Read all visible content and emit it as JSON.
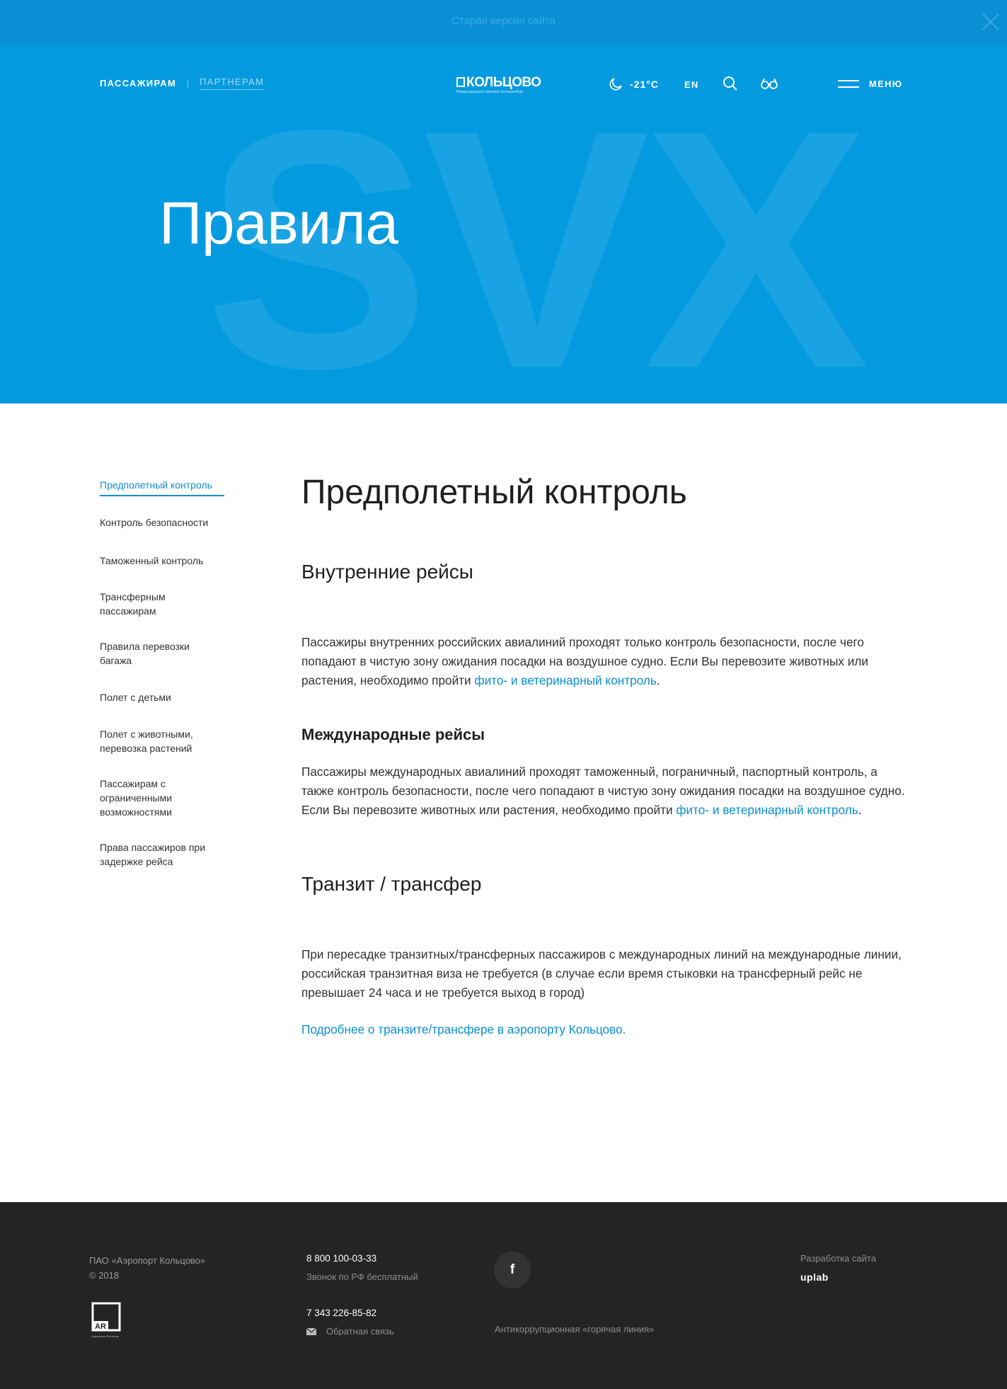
{
  "notice": {
    "text": "Старая версия сайта",
    "close_icon": "close-icon"
  },
  "header": {
    "nav": {
      "passengers": "ПАССАЖИРАМ",
      "partners": "ПАРТНЕРАМ"
    },
    "logo": {
      "text": "КОЛЬЦОВО",
      "subtext": "Международный аэропорт Екатеринбург"
    },
    "weather": {
      "icon": "moon-icon",
      "temperature": "-21°C"
    },
    "lang": "EN",
    "search_icon": "search-icon",
    "accessibility_icon": "glasses-icon",
    "menu_label": "МЕНЮ",
    "background_text": "SVX"
  },
  "hero": {
    "title": "Правила"
  },
  "sidebar": {
    "active_index": 0,
    "items": [
      {
        "label": "Предполетный контроль"
      },
      {
        "label": "Контроль безопасности"
      },
      {
        "label": "Таможенный контроль"
      },
      {
        "label": "Трансферным пассажирам"
      },
      {
        "label": "Правила перевозки багажа"
      },
      {
        "label": "Полет с детьми"
      },
      {
        "label": "Полет с животными, перевозка растений"
      },
      {
        "label": "Пассажирам с ограниченными возможностями"
      },
      {
        "label": "Права пассажиров при задержке рейса"
      }
    ]
  },
  "content": {
    "title": "Предполетный контроль",
    "domestic": {
      "heading": "Внутренние рейсы",
      "text": "Пассажиры внутренних российских авиалиний проходят только контроль безопасности, после чего попадают в чистую зону ожидания посадки на воздушное судно. Если Вы перевозите животных или растения, необходимо пройти ",
      "link": "фито- и ветеринарный контроль",
      "end": "."
    },
    "international": {
      "heading": "Международные рейсы",
      "text": "Пассажиры международных авиалиний проходят таможенный, пограничный, паспортный контроль, а также контроль безопасности, после чего попадают в чистую зону ожидания посадки на воздушное судно. Если Вы перевозите животных или растения, необходимо пройти ",
      "link": "фито- и ветеринарный контроль",
      "end": "."
    },
    "transit": {
      "heading": "Транзит / трансфер",
      "text": "При пересадке транзитных/трансферных пассажиров с международных линий на международные линии, российская транзитная виза не требуется (в случае если время стыковки на трансферный рейс не превышает 24 часа и не требуется выход в город)",
      "more_link": "Подробнее о транзите/трансфере в аэропорту Кольцово."
    }
  },
  "footer": {
    "company": "ПАО «Аэропорт Кольцово»",
    "copyright": "© 2018",
    "ar_logo": {
      "mark": "AR",
      "caption": "Аэропорты Регионов"
    },
    "phone_free": "8 800 100-03-33",
    "phone_free_note": "Звонок по РФ бесплатный",
    "phone_local": "7 343 226-85-82",
    "feedback_icon": "mail-icon",
    "feedback": "Обратная связь",
    "facebook_icon": "facebook-icon",
    "facebook_glyph": "f",
    "hotline": "Антикоррупционная «горячая линия»",
    "dev_label": "Разработка сайта",
    "dev_name": "uplab"
  },
  "colors": {
    "brand_blue": "#039ae0",
    "notice_bar": "#0a8fd4",
    "link": "#0a8fd4",
    "footer_bg": "#242424"
  }
}
